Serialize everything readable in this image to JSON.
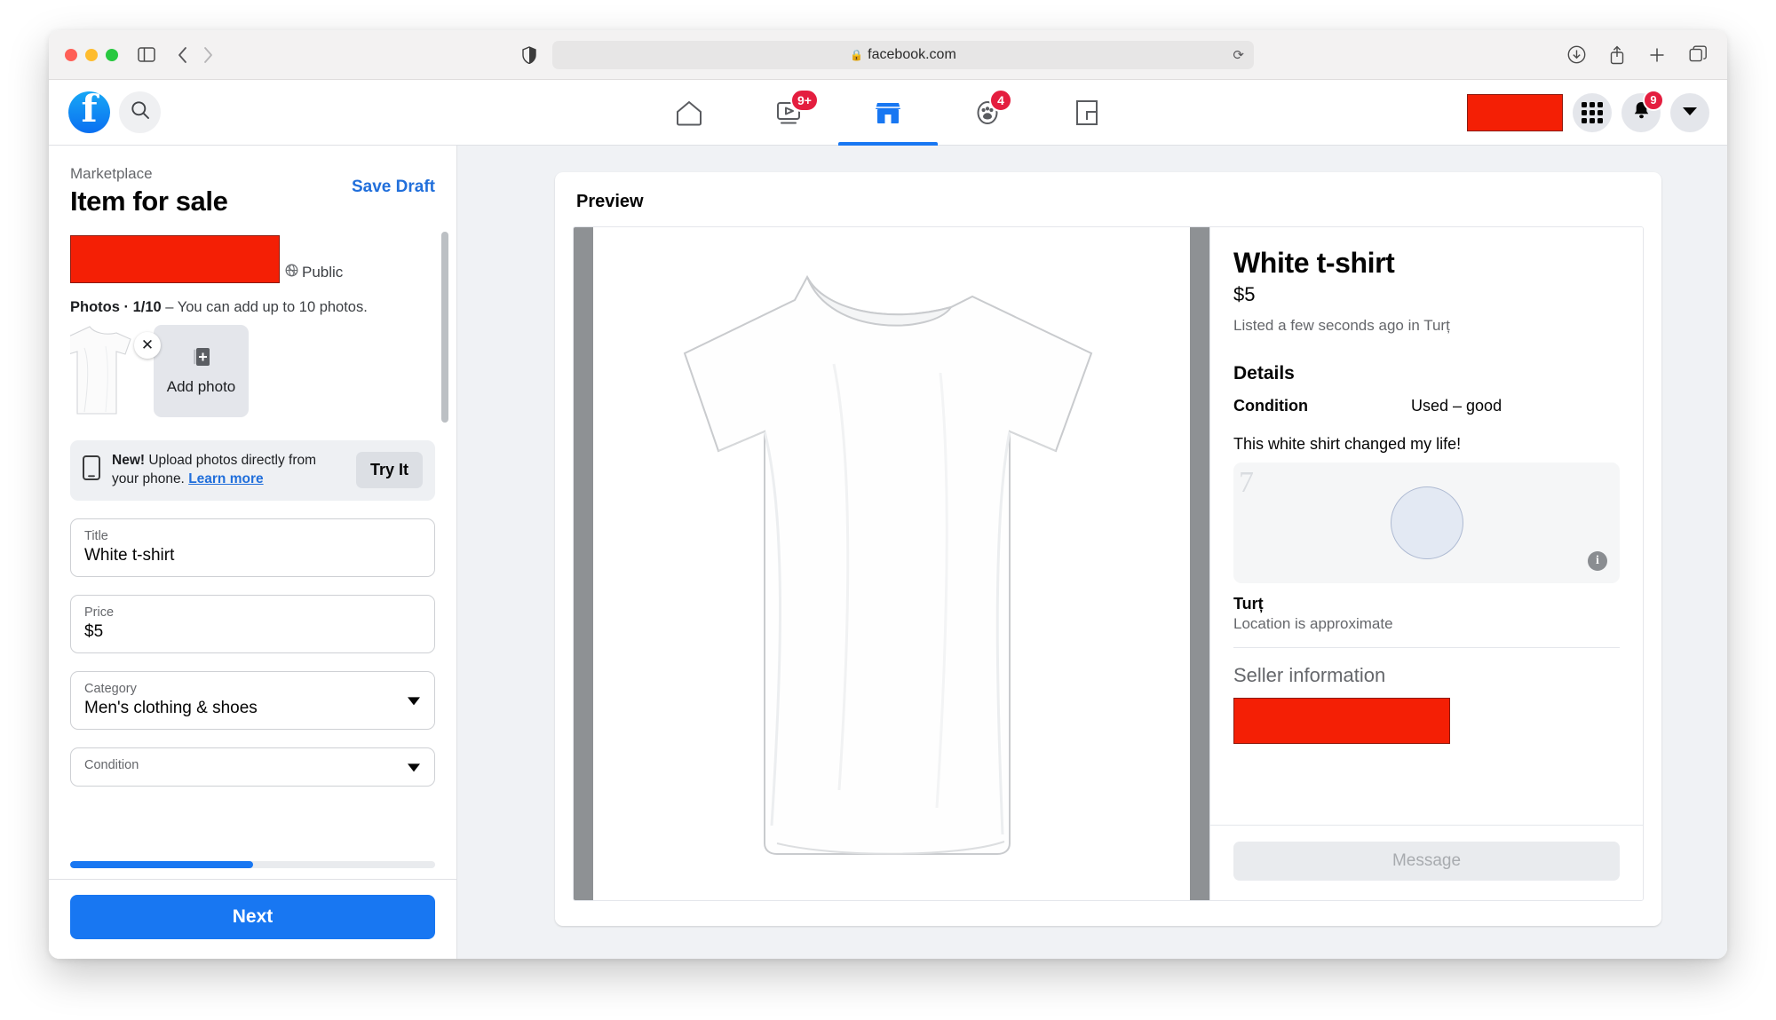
{
  "browser": {
    "url": "facebook.com",
    "lock_icon": "lock-icon",
    "reload_icon": "reload-icon",
    "traffic_lights": [
      "close",
      "minimize",
      "zoom"
    ],
    "sidebar_icon": "sidebar-toggle-icon",
    "back_icon": "back-arrow-icon",
    "forward_icon": "forward-arrow-icon",
    "shield_icon": "privacy-shield-icon",
    "right_icons": [
      "download-icon",
      "share-icon",
      "new-tab-icon",
      "tab-overview-icon"
    ]
  },
  "fb_header": {
    "logo_letter": "f",
    "search_icon": "search-icon",
    "nav": [
      {
        "name": "home",
        "icon": "home-icon",
        "badge": "",
        "active": false
      },
      {
        "name": "video",
        "icon": "video-icon",
        "badge": "9+",
        "active": false
      },
      {
        "name": "marketplace",
        "icon": "marketplace-icon",
        "badge": "",
        "active": true
      },
      {
        "name": "groups",
        "icon": "groups-icon",
        "badge": "4",
        "active": false
      },
      {
        "name": "gaming",
        "icon": "gaming-icon",
        "badge": "",
        "active": false
      }
    ],
    "account_name_redacted": "",
    "menu_icon": "grid-menu-icon",
    "bell_icon": "bell-icon",
    "bell_badge": "9",
    "account_caret_icon": "chevron-down-icon"
  },
  "composer": {
    "breadcrumb": "Marketplace",
    "title": "Item for sale",
    "save_draft": "Save Draft",
    "audience": "Public",
    "audience_icon": "globe-icon",
    "photos_label_bold": "Photos · 1/10",
    "photos_label_rest": " – You can add up to 10 photos.",
    "remove_photo_icon": "close-icon",
    "add_photo_label": "Add photo",
    "add_photo_icon": "add-image-icon",
    "promo": {
      "icon": "phone-icon",
      "bold": "New!",
      "text": " Upload photos directly from your phone. ",
      "link": "Learn more",
      "button": "Try It"
    },
    "fields": [
      {
        "label": "Title",
        "value": "White t-shirt",
        "caret": false
      },
      {
        "label": "Price",
        "value": "$5",
        "caret": false
      },
      {
        "label": "Category",
        "value": "Men's clothing & shoes",
        "caret": true
      },
      {
        "label": "Condition",
        "value": "",
        "caret": true
      }
    ],
    "progress_percent": "50",
    "next_label": "Next"
  },
  "preview": {
    "heading": "Preview",
    "item_title": "White t-shirt",
    "price": "$5",
    "listed": "Listed a few seconds ago in Turț",
    "details_heading": "Details",
    "condition_key": "Condition",
    "condition_value": "Used – good",
    "description": "This white shirt changed my life!",
    "map_label": "7",
    "map_info_icon": "info-icon",
    "location_name": "Turț",
    "location_sub": "Location is approximate",
    "seller_heading": "Seller information",
    "seller_name_redacted": "",
    "message_button": "Message"
  },
  "colors": {
    "fb_blue": "#1877f2",
    "link_blue": "#216fdb",
    "badge_red": "#e41e3f",
    "redaction_red": "#f41f05"
  }
}
